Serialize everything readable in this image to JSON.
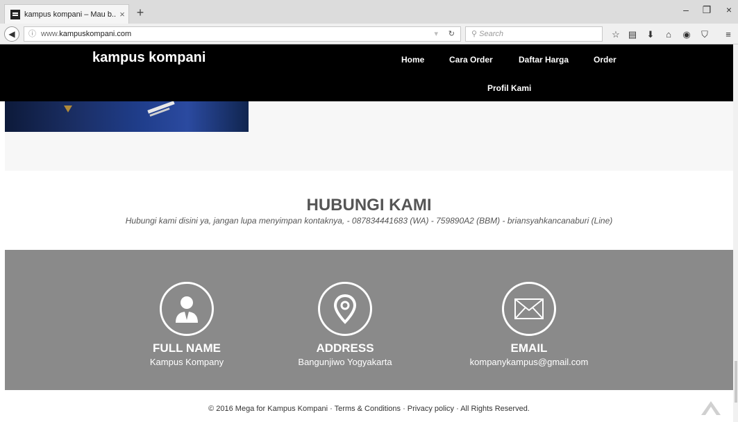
{
  "browser": {
    "tab_title": "kampus kompani – Mau b...",
    "tab_close": "×",
    "new_tab": "+",
    "url_prefix": "www.",
    "url_domain": "kampuskompani.com",
    "search_placeholder": "Search",
    "controls": {
      "minimize": "–",
      "restore": "❐",
      "close": "×"
    }
  },
  "header": {
    "brand": "kampus kompani",
    "menu": [
      "Home",
      "Cara Order",
      "Daftar Harga",
      "Order",
      "Profil Kami"
    ]
  },
  "contact": {
    "title": "HUBUNGI KAMI",
    "description": "Hubungi kami disini ya, jangan lupa menyimpan kontaknya, - 087834441683 (WA) - 759890A2 (BBM) - briansyahkancanaburi (Line)"
  },
  "info": [
    {
      "icon": "person-icon",
      "label": "FULL NAME",
      "value": "Kampus Kompany"
    },
    {
      "icon": "location-pin-icon",
      "label": "ADDRESS",
      "value": "Bangunjiwo Yogyakarta"
    },
    {
      "icon": "envelope-icon",
      "label": "EMAIL",
      "value": "kompanykampus@gmail.com"
    }
  ],
  "footer": {
    "copyright": "© 2016 Mega for Kampus Kompani · Terms & Conditions · Privacy policy · All Rights Reserved."
  },
  "colors": {
    "header_bg": "#000000",
    "info_band_bg": "#8a8a8a",
    "title_color": "#555555"
  }
}
